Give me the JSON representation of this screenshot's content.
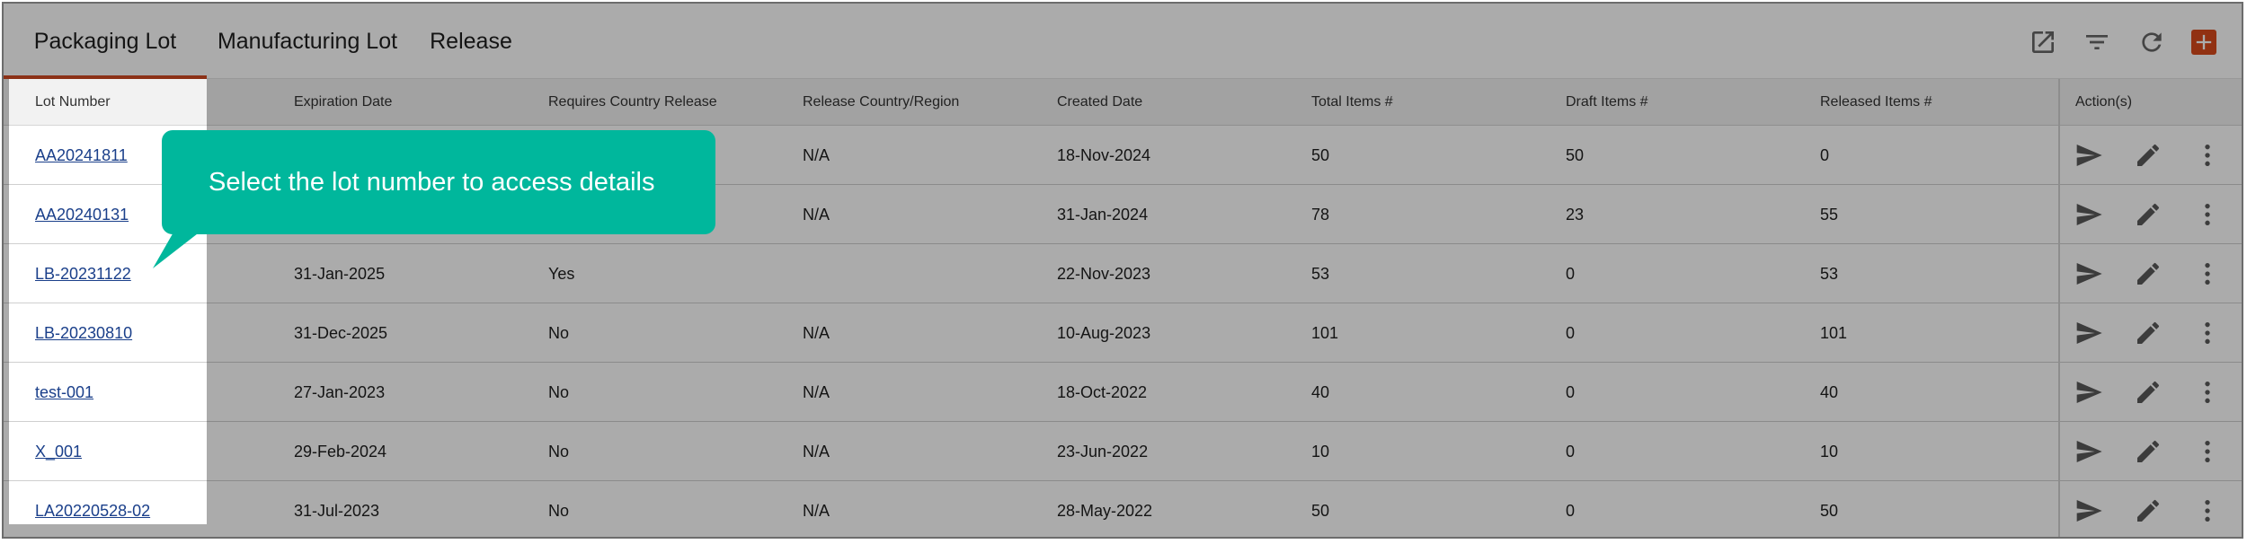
{
  "tabs": [
    {
      "label": "Packaging Lot",
      "active": true
    },
    {
      "label": "Manufacturing Lot",
      "active": false
    },
    {
      "label": "Release",
      "active": false
    }
  ],
  "toolbar": {
    "icons": [
      "open-external-icon",
      "filter-icon",
      "refresh-icon",
      "add-icon"
    ],
    "accent": "#d84a1b"
  },
  "table": {
    "headers": {
      "lot_number": "Lot Number",
      "expiration_date": "Expiration Date",
      "requires_country_release": "Requires Country Release",
      "release_country_region": "Release Country/Region",
      "created_date": "Created Date",
      "total_items": "Total Items #",
      "draft_items": "Draft Items #",
      "released_items": "Released Items #",
      "actions": "Action(s)"
    },
    "rows": [
      {
        "lot": "AA20241811",
        "exp": "",
        "req": "",
        "country": "N/A",
        "created": "18-Nov-2024",
        "total": "50",
        "draft": "50",
        "released": "0"
      },
      {
        "lot": "AA20240131",
        "exp": "",
        "req": "",
        "country": "N/A",
        "created": "31-Jan-2024",
        "total": "78",
        "draft": "23",
        "released": "55"
      },
      {
        "lot": "LB-20231122",
        "exp": "31-Jan-2025",
        "req": "Yes",
        "country": "",
        "created": "22-Nov-2023",
        "total": "53",
        "draft": "0",
        "released": "53"
      },
      {
        "lot": "LB-20230810",
        "exp": "31-Dec-2025",
        "req": "No",
        "country": "N/A",
        "created": "10-Aug-2023",
        "total": "101",
        "draft": "0",
        "released": "101"
      },
      {
        "lot": "test-001",
        "exp": "27-Jan-2023",
        "req": "No",
        "country": "N/A",
        "created": "18-Oct-2022",
        "total": "40",
        "draft": "0",
        "released": "40"
      },
      {
        "lot": "X_001",
        "exp": "29-Feb-2024",
        "req": "No",
        "country": "N/A",
        "created": "23-Jun-2022",
        "total": "10",
        "draft": "0",
        "released": "10"
      },
      {
        "lot": "LA20220528-02",
        "exp": "31-Jul-2023",
        "req": "No",
        "country": "N/A",
        "created": "28-May-2022",
        "total": "50",
        "draft": "0",
        "released": "50"
      }
    ],
    "row_actions": [
      "send-icon",
      "edit-pencil-icon",
      "more-vertical-icon"
    ]
  },
  "tooltip": {
    "text": "Select the lot number to access details",
    "color": "#00b79c"
  }
}
